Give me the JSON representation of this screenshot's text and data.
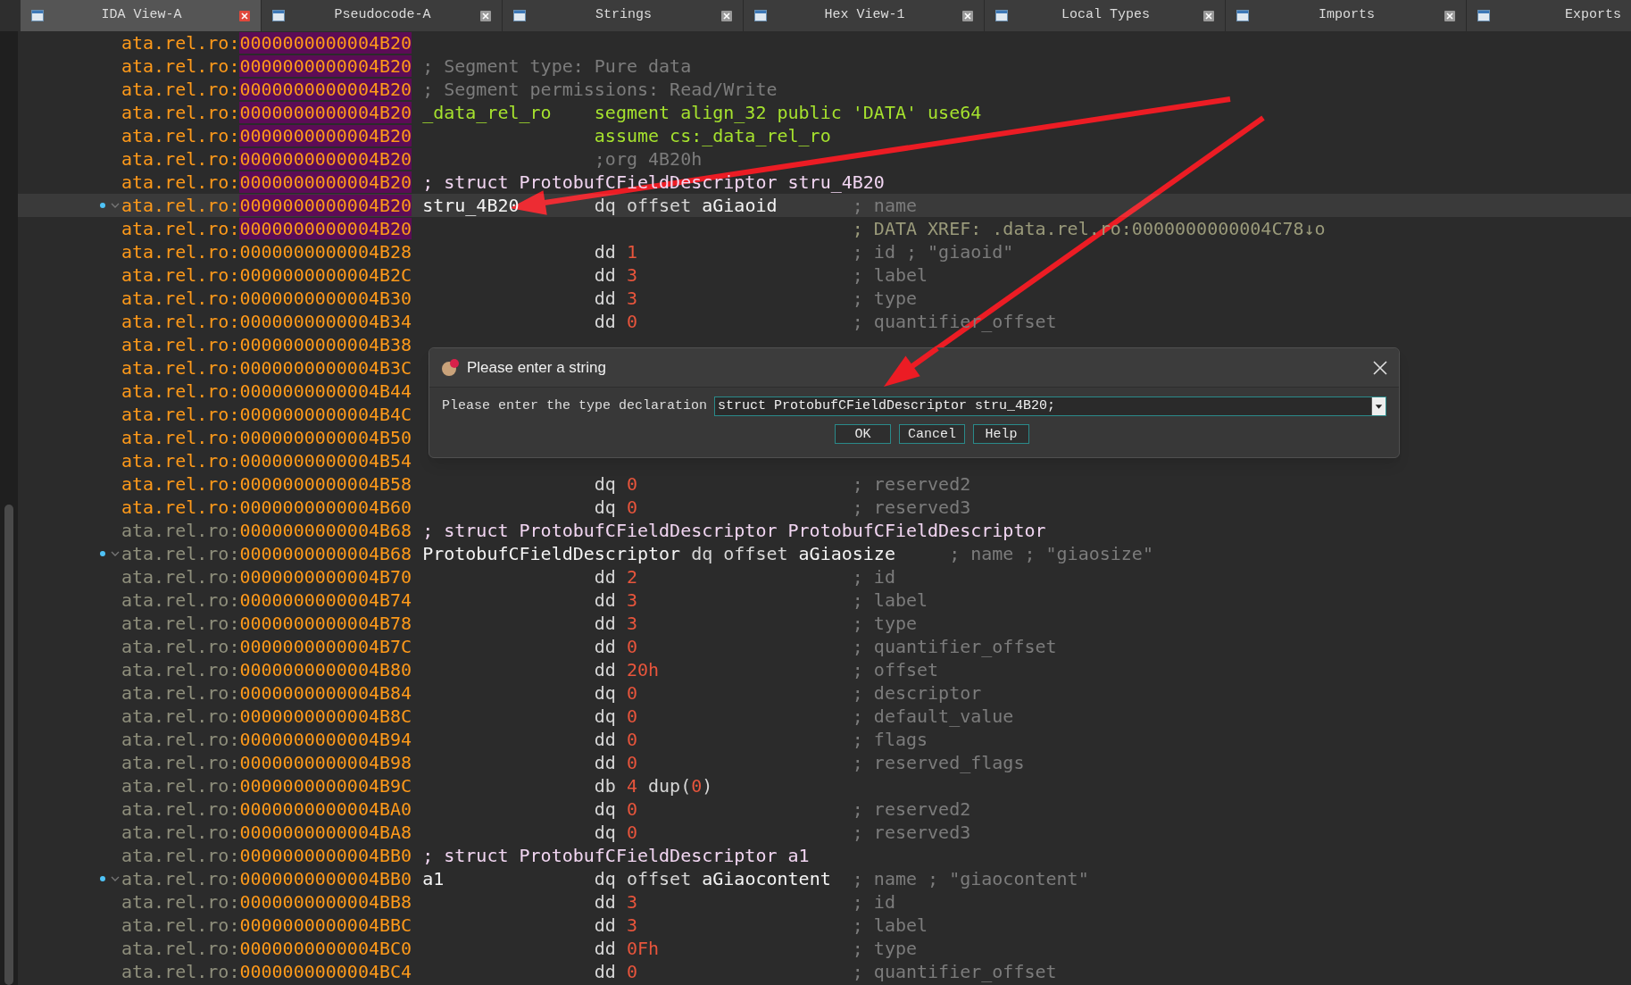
{
  "tabs": [
    {
      "label": "IDA View-A",
      "selected": true,
      "closable": true
    },
    {
      "label": "Pseudocode-A",
      "selected": false,
      "closable": true
    },
    {
      "label": "Strings",
      "selected": false,
      "closable": true
    },
    {
      "label": "Hex View-1",
      "selected": false,
      "closable": true
    },
    {
      "label": "Local Types",
      "selected": false,
      "closable": true
    },
    {
      "label": "Imports",
      "selected": false,
      "closable": true
    },
    {
      "label": "Exports",
      "selected": false,
      "closable": false
    }
  ],
  "rows": [
    {
      "seg": "ata.rel.ro:",
      "addr": "0000000000004B20",
      "kind": "struct",
      "addr_marked": true,
      "selected": false,
      "node": false
    },
    {
      "seg": "ata.rel.ro:",
      "addr": "0000000000004B20",
      "kind": "struct",
      "addr_marked": true,
      "selected": false,
      "node": false,
      "label": {
        "text": "; Segment type: Pure data",
        "kind": "comment"
      }
    },
    {
      "seg": "ata.rel.ro:",
      "addr": "0000000000004B20",
      "kind": "struct",
      "addr_marked": true,
      "selected": false,
      "node": false,
      "label": {
        "text": "; Segment permissions: Read/Write",
        "kind": "comment"
      }
    },
    {
      "seg": "ata.rel.ro:",
      "addr": "0000000000004B20",
      "kind": "struct",
      "addr_marked": true,
      "selected": false,
      "node": false,
      "label": {
        "text": "_data_rel_ro",
        "kind": "directive"
      },
      "code": [
        {
          "text": "segment align_32 public 'DATA' use64",
          "kind": "directive"
        }
      ]
    },
    {
      "seg": "ata.rel.ro:",
      "addr": "0000000000004B20",
      "kind": "struct",
      "addr_marked": true,
      "selected": false,
      "node": false,
      "code": [
        {
          "text": "assume cs:_data_rel_ro",
          "kind": "directive"
        }
      ]
    },
    {
      "seg": "ata.rel.ro:",
      "addr": "0000000000004B20",
      "kind": "struct",
      "addr_marked": true,
      "selected": false,
      "node": false,
      "code": [
        {
          "text": ";org 4B20h",
          "kind": "comment"
        }
      ]
    },
    {
      "seg": "ata.rel.ro:",
      "addr": "0000000000004B20",
      "kind": "struct",
      "addr_marked": true,
      "selected": false,
      "node": false,
      "label": {
        "text": "; struct ProtobufCFieldDescriptor stru_4B20",
        "kind": "struct_comment"
      }
    },
    {
      "seg": "ata.rel.ro:",
      "addr": "0000000000004B20",
      "kind": "struct",
      "addr_marked": true,
      "selected": true,
      "node": true,
      "label": {
        "text": "stru_4B20",
        "kind": "name"
      },
      "code": [
        {
          "text": "dq offset ",
          "kind": "op"
        },
        {
          "text": "aGiaoid",
          "kind": "name"
        }
      ],
      "comment": {
        "text": "; name",
        "kind": "comment"
      }
    },
    {
      "seg": "ata.rel.ro:",
      "addr": "0000000000004B20",
      "kind": "struct",
      "addr_marked": true,
      "selected": false,
      "node": false,
      "comment": {
        "text": "; DATA XREF: .data.rel.ro:0000000000004C78↓o",
        "kind": "xref"
      }
    },
    {
      "seg": "ata.rel.ro:",
      "addr": "0000000000004B28",
      "kind": "struct",
      "addr_marked": false,
      "selected": false,
      "node": false,
      "code": [
        {
          "text": "dd ",
          "kind": "op"
        },
        {
          "text": "1",
          "kind": "num"
        }
      ],
      "comment": {
        "text": "; id ; \"giaoid\"",
        "kind": "comment"
      }
    },
    {
      "seg": "ata.rel.ro:",
      "addr": "0000000000004B2C",
      "kind": "struct",
      "addr_marked": false,
      "selected": false,
      "node": false,
      "code": [
        {
          "text": "dd ",
          "kind": "op"
        },
        {
          "text": "3",
          "kind": "num"
        }
      ],
      "comment": {
        "text": "; label",
        "kind": "comment"
      }
    },
    {
      "seg": "ata.rel.ro:",
      "addr": "0000000000004B30",
      "kind": "struct",
      "addr_marked": false,
      "selected": false,
      "node": false,
      "code": [
        {
          "text": "dd ",
          "kind": "op"
        },
        {
          "text": "3",
          "kind": "num"
        }
      ],
      "comment": {
        "text": "; type",
        "kind": "comment"
      }
    },
    {
      "seg": "ata.rel.ro:",
      "addr": "0000000000004B34",
      "kind": "struct",
      "addr_marked": false,
      "selected": false,
      "node": false,
      "code": [
        {
          "text": "dd ",
          "kind": "op"
        },
        {
          "text": "0",
          "kind": "num"
        }
      ],
      "comment": {
        "text": "; quantifier_offset",
        "kind": "comment"
      }
    },
    {
      "seg": "ata.rel.ro:",
      "addr": "0000000000004B38",
      "kind": "struct",
      "addr_marked": false,
      "selected": false,
      "node": false
    },
    {
      "seg": "ata.rel.ro:",
      "addr": "0000000000004B3C",
      "kind": "struct",
      "addr_marked": false,
      "selected": false,
      "node": false
    },
    {
      "seg": "ata.rel.ro:",
      "addr": "0000000000004B44",
      "kind": "struct",
      "addr_marked": false,
      "selected": false,
      "node": false
    },
    {
      "seg": "ata.rel.ro:",
      "addr": "0000000000004B4C",
      "kind": "struct",
      "addr_marked": false,
      "selected": false,
      "node": false
    },
    {
      "seg": "ata.rel.ro:",
      "addr": "0000000000004B50",
      "kind": "struct",
      "addr_marked": false,
      "selected": false,
      "node": false
    },
    {
      "seg": "ata.rel.ro:",
      "addr": "0000000000004B54",
      "kind": "struct",
      "addr_marked": false,
      "selected": false,
      "node": false
    },
    {
      "seg": "ata.rel.ro:",
      "addr": "0000000000004B58",
      "kind": "struct",
      "addr_marked": false,
      "selected": false,
      "node": false,
      "code": [
        {
          "text": "dq ",
          "kind": "op"
        },
        {
          "text": "0",
          "kind": "num"
        }
      ],
      "comment": {
        "text": "; reserved2",
        "kind": "comment"
      }
    },
    {
      "seg": "ata.rel.ro:",
      "addr": "0000000000004B60",
      "kind": "struct",
      "addr_marked": false,
      "selected": false,
      "node": false,
      "code": [
        {
          "text": "dq ",
          "kind": "op"
        },
        {
          "text": "0",
          "kind": "num"
        }
      ],
      "comment": {
        "text": "; reserved3",
        "kind": "comment"
      }
    },
    {
      "seg": "ata.rel.ro:",
      "addr": "0000000000004B68",
      "kind": "plain",
      "addr_marked": false,
      "selected": false,
      "node": false,
      "label": {
        "text": "; struct ProtobufCFieldDescriptor ProtobufCFieldDescriptor",
        "kind": "struct_comment"
      }
    },
    {
      "seg": "ata.rel.ro:",
      "addr": "0000000000004B68",
      "kind": "plain",
      "addr_marked": false,
      "selected": false,
      "node": true,
      "label": {
        "text": "ProtobufCFieldDescriptor",
        "kind": "name"
      },
      "code": [
        {
          "text": "dq offset ",
          "kind": "op"
        },
        {
          "text": "aGiaosize",
          "kind": "name"
        }
      ],
      "comment": {
        "text": "; name ; \"giaosize\"",
        "kind": "comment"
      }
    },
    {
      "seg": "ata.rel.ro:",
      "addr": "0000000000004B70",
      "kind": "plain",
      "addr_marked": false,
      "selected": false,
      "node": false,
      "code": [
        {
          "text": "dd ",
          "kind": "op"
        },
        {
          "text": "2",
          "kind": "num"
        }
      ],
      "comment": {
        "text": "; id",
        "kind": "comment"
      }
    },
    {
      "seg": "ata.rel.ro:",
      "addr": "0000000000004B74",
      "kind": "plain",
      "addr_marked": false,
      "selected": false,
      "node": false,
      "code": [
        {
          "text": "dd ",
          "kind": "op"
        },
        {
          "text": "3",
          "kind": "num"
        }
      ],
      "comment": {
        "text": "; label",
        "kind": "comment"
      }
    },
    {
      "seg": "ata.rel.ro:",
      "addr": "0000000000004B78",
      "kind": "plain",
      "addr_marked": false,
      "selected": false,
      "node": false,
      "code": [
        {
          "text": "dd ",
          "kind": "op"
        },
        {
          "text": "3",
          "kind": "num"
        }
      ],
      "comment": {
        "text": "; type",
        "kind": "comment"
      }
    },
    {
      "seg": "ata.rel.ro:",
      "addr": "0000000000004B7C",
      "kind": "plain",
      "addr_marked": false,
      "selected": false,
      "node": false,
      "code": [
        {
          "text": "dd ",
          "kind": "op"
        },
        {
          "text": "0",
          "kind": "num"
        }
      ],
      "comment": {
        "text": "; quantifier_offset",
        "kind": "comment"
      }
    },
    {
      "seg": "ata.rel.ro:",
      "addr": "0000000000004B80",
      "kind": "plain",
      "addr_marked": false,
      "selected": false,
      "node": false,
      "code": [
        {
          "text": "dd ",
          "kind": "op"
        },
        {
          "text": "20h",
          "kind": "num"
        }
      ],
      "comment": {
        "text": "; offset",
        "kind": "comment"
      }
    },
    {
      "seg": "ata.rel.ro:",
      "addr": "0000000000004B84",
      "kind": "plain",
      "addr_marked": false,
      "selected": false,
      "node": false,
      "code": [
        {
          "text": "dq ",
          "kind": "op"
        },
        {
          "text": "0",
          "kind": "num"
        }
      ],
      "comment": {
        "text": "; descriptor",
        "kind": "comment"
      }
    },
    {
      "seg": "ata.rel.ro:",
      "addr": "0000000000004B8C",
      "kind": "plain",
      "addr_marked": false,
      "selected": false,
      "node": false,
      "code": [
        {
          "text": "dq ",
          "kind": "op"
        },
        {
          "text": "0",
          "kind": "num"
        }
      ],
      "comment": {
        "text": "; default_value",
        "kind": "comment"
      }
    },
    {
      "seg": "ata.rel.ro:",
      "addr": "0000000000004B94",
      "kind": "plain",
      "addr_marked": false,
      "selected": false,
      "node": false,
      "code": [
        {
          "text": "dd ",
          "kind": "op"
        },
        {
          "text": "0",
          "kind": "num"
        }
      ],
      "comment": {
        "text": "; flags",
        "kind": "comment"
      }
    },
    {
      "seg": "ata.rel.ro:",
      "addr": "0000000000004B98",
      "kind": "plain",
      "addr_marked": false,
      "selected": false,
      "node": false,
      "code": [
        {
          "text": "dd ",
          "kind": "op"
        },
        {
          "text": "0",
          "kind": "num"
        }
      ],
      "comment": {
        "text": "; reserved_flags",
        "kind": "comment"
      }
    },
    {
      "seg": "ata.rel.ro:",
      "addr": "0000000000004B9C",
      "kind": "plain",
      "addr_marked": false,
      "selected": false,
      "node": false,
      "code": [
        {
          "text": "db ",
          "kind": "op"
        },
        {
          "text": "4",
          "kind": "num"
        },
        {
          "text": " dup(",
          "kind": "op"
        },
        {
          "text": "0",
          "kind": "num"
        },
        {
          "text": ")",
          "kind": "op"
        }
      ]
    },
    {
      "seg": "ata.rel.ro:",
      "addr": "0000000000004BA0",
      "kind": "plain",
      "addr_marked": false,
      "selected": false,
      "node": false,
      "code": [
        {
          "text": "dq ",
          "kind": "op"
        },
        {
          "text": "0",
          "kind": "num"
        }
      ],
      "comment": {
        "text": "; reserved2",
        "kind": "comment"
      }
    },
    {
      "seg": "ata.rel.ro:",
      "addr": "0000000000004BA8",
      "kind": "plain",
      "addr_marked": false,
      "selected": false,
      "node": false,
      "code": [
        {
          "text": "dq ",
          "kind": "op"
        },
        {
          "text": "0",
          "kind": "num"
        }
      ],
      "comment": {
        "text": "; reserved3",
        "kind": "comment"
      }
    },
    {
      "seg": "ata.rel.ro:",
      "addr": "0000000000004BB0",
      "kind": "plain",
      "addr_marked": false,
      "selected": false,
      "node": false,
      "label": {
        "text": "; struct ProtobufCFieldDescriptor a1",
        "kind": "struct_comment"
      }
    },
    {
      "seg": "ata.rel.ro:",
      "addr": "0000000000004BB0",
      "kind": "plain",
      "addr_marked": false,
      "selected": false,
      "node": true,
      "label": {
        "text": "a1",
        "kind": "name"
      },
      "code": [
        {
          "text": "dq offset ",
          "kind": "op"
        },
        {
          "text": "aGiaocontent",
          "kind": "name"
        }
      ],
      "comment": {
        "text": "; name ; \"giaocontent\"",
        "kind": "comment"
      }
    },
    {
      "seg": "ata.rel.ro:",
      "addr": "0000000000004BB8",
      "kind": "plain",
      "addr_marked": false,
      "selected": false,
      "node": false,
      "code": [
        {
          "text": "dd ",
          "kind": "op"
        },
        {
          "text": "3",
          "kind": "num"
        }
      ],
      "comment": {
        "text": "; id",
        "kind": "comment"
      }
    },
    {
      "seg": "ata.rel.ro:",
      "addr": "0000000000004BBC",
      "kind": "plain",
      "addr_marked": false,
      "selected": false,
      "node": false,
      "code": [
        {
          "text": "dd ",
          "kind": "op"
        },
        {
          "text": "3",
          "kind": "num"
        }
      ],
      "comment": {
        "text": "; label",
        "kind": "comment"
      }
    },
    {
      "seg": "ata.rel.ro:",
      "addr": "0000000000004BC0",
      "kind": "plain",
      "addr_marked": false,
      "selected": false,
      "node": false,
      "code": [
        {
          "text": "dd ",
          "kind": "op"
        },
        {
          "text": "0Fh",
          "kind": "num"
        }
      ],
      "comment": {
        "text": "; type",
        "kind": "comment"
      }
    },
    {
      "seg": "ata.rel.ro:",
      "addr": "0000000000004BC4",
      "kind": "plain",
      "addr_marked": false,
      "selected": false,
      "node": false,
      "code": [
        {
          "text": "dd ",
          "kind": "op"
        },
        {
          "text": "0",
          "kind": "num"
        }
      ],
      "comment": {
        "text": "; quantifier_offset",
        "kind": "comment"
      }
    }
  ],
  "dialog": {
    "title": "Please enter a string",
    "prompt": "Please enter the type declaration",
    "value": "struct ProtobufCFieldDescriptor stru_4B20;",
    "buttons": [
      "OK",
      "Cancel",
      "Help"
    ]
  }
}
